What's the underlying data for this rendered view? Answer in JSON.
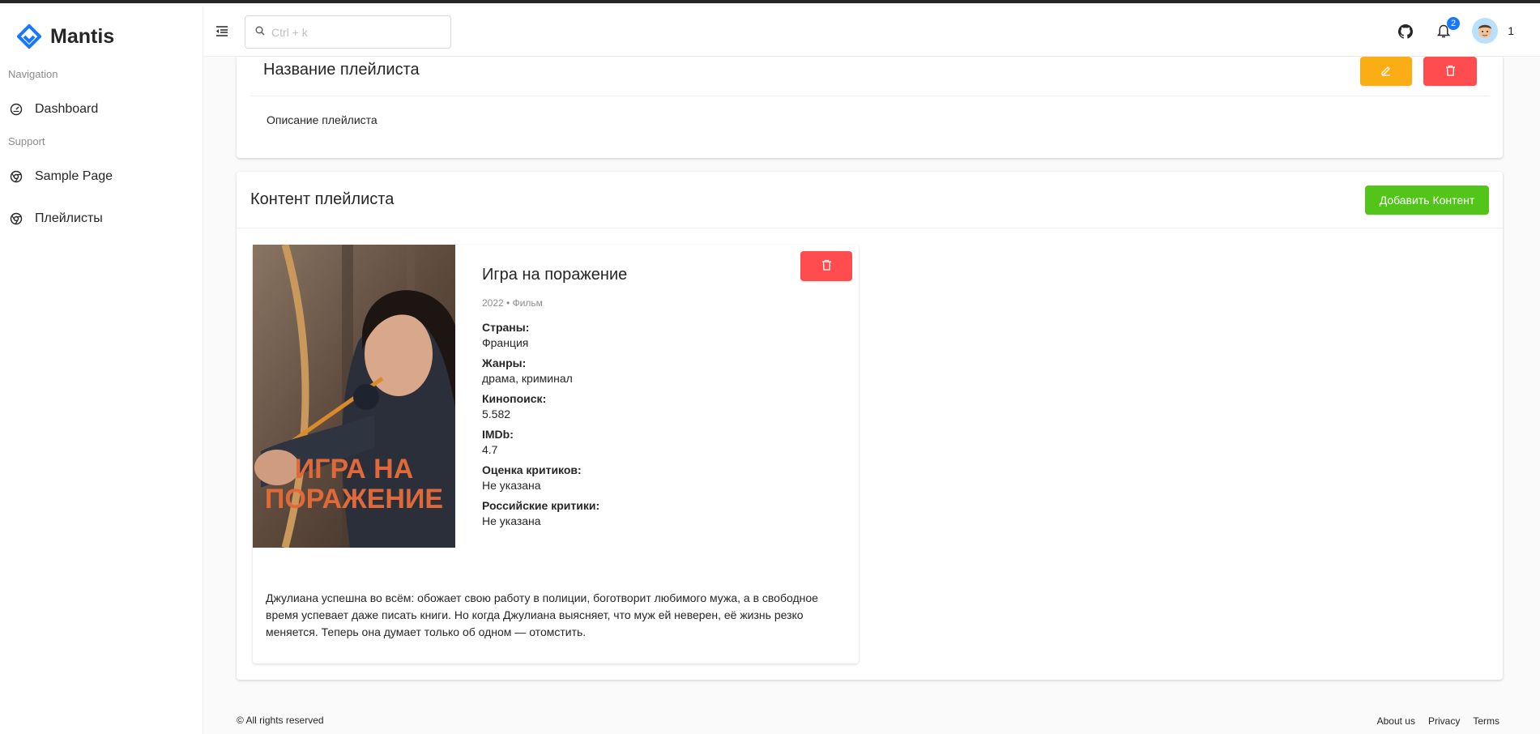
{
  "app": {
    "name": "Mantis",
    "accent": "#1677ff"
  },
  "sidebar": {
    "groups": [
      {
        "label": "Navigation",
        "items": [
          {
            "label": "Dashboard",
            "icon": "dashboard-icon"
          }
        ]
      },
      {
        "label": "Support",
        "items": [
          {
            "label": "Sample Page",
            "icon": "chrome-icon"
          },
          {
            "label": "Плейлисты",
            "icon": "chrome-icon"
          }
        ]
      }
    ]
  },
  "header": {
    "search_placeholder": "Ctrl + k",
    "notifications_count": "2",
    "user_name": "1"
  },
  "playlist": {
    "title": "Название плейлиста",
    "description": "Описание плейлиста"
  },
  "content": {
    "title": "Контент плейлиста",
    "add_button": "Добавить Контент",
    "movie": {
      "title": "Игра на поражение",
      "poster_title_line1": "ИГРА НА",
      "poster_title_line2": "ПОРАЖЕНИЕ",
      "meta": "2022 • Фильм",
      "fields": [
        {
          "label": "Страны:",
          "value": "Франция"
        },
        {
          "label": "Жанры:",
          "value": "драма, криминал"
        },
        {
          "label": "Кинопоиск:",
          "value": "5.582"
        },
        {
          "label": "IMDb:",
          "value": "4.7"
        },
        {
          "label": "Оценка критиков:",
          "value": "Не указана"
        },
        {
          "label": "Российские критики:",
          "value": "Не указана"
        }
      ],
      "description": "Джулиана успешна во всём: обожает свою работу в полиции, боготворит любимого мужа, а в свободное время успевает даже писать книги. Но когда Джулиана выясняет, что муж ей неверен, её жизнь резко меняется. Теперь она думает только об одном — отомстить."
    }
  },
  "footer": {
    "copyright": "© All rights reserved",
    "links": [
      "About us",
      "Privacy",
      "Terms"
    ]
  },
  "colors": {
    "edit": "#faad14",
    "delete": "#ff4d4f",
    "add": "#52c41a"
  }
}
